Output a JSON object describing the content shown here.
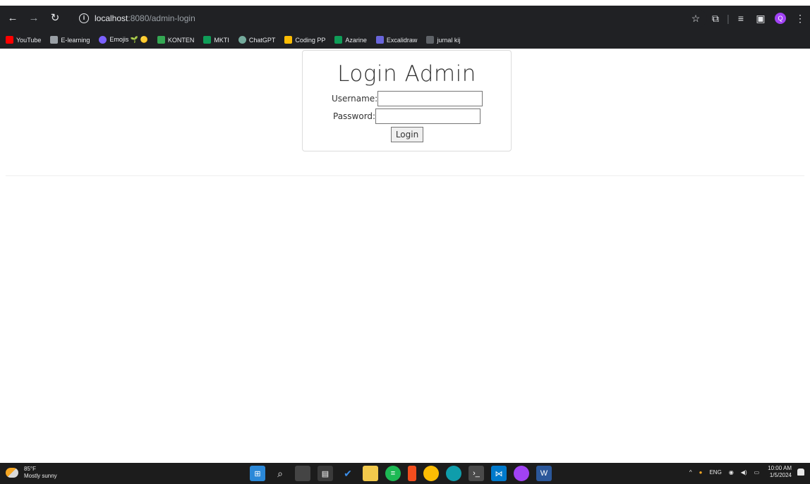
{
  "browser": {
    "url_host": "localhost",
    "url_rest": ":8080/admin-login"
  },
  "bookmarks": [
    {
      "label": "YouTube",
      "color": "#ff0000"
    },
    {
      "label": "E-learning",
      "color": "#9aa0a6"
    },
    {
      "label": "Emojis 🌱 🟡",
      "color": "#7b61ff"
    },
    {
      "label": "KONTEN",
      "color": "#34a853"
    },
    {
      "label": "MKTI",
      "color": "#0f9d58"
    },
    {
      "label": "ChatGPT",
      "color": "#74aa9c"
    },
    {
      "label": "Coding PP",
      "color": "#fbbc04"
    },
    {
      "label": "Azarine",
      "color": "#0f9d58"
    },
    {
      "label": "Excalidraw",
      "color": "#6965db"
    },
    {
      "label": "jurnal kij",
      "color": "#5f6368"
    }
  ],
  "login": {
    "title": "Login Admin",
    "username_label": "Username:",
    "password_label": "Password:",
    "submit_label": "Login"
  },
  "taskbar": {
    "temperature": "85°F",
    "weather": "Mostly sunny",
    "language": "ENG",
    "time": "10:00 AM",
    "date": "1/5/2024"
  }
}
